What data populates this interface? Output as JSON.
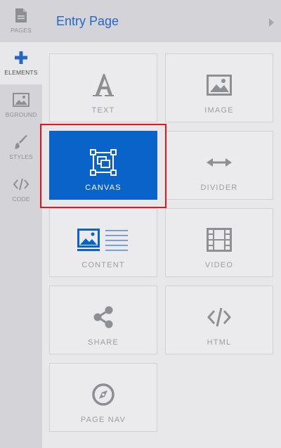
{
  "rail": {
    "items": [
      {
        "label": "PAGES",
        "icon": "page-icon"
      },
      {
        "label": "ELEMENTS",
        "icon": "plus-icon"
      },
      {
        "label": "BGROUND",
        "icon": "image-icon"
      },
      {
        "label": "STYLES",
        "icon": "brush-icon"
      },
      {
        "label": "CODE",
        "icon": "code-icon"
      }
    ]
  },
  "header": {
    "title": "Entry Page"
  },
  "tiles": [
    {
      "label": "TEXT",
      "icon": "text-icon"
    },
    {
      "label": "IMAGE",
      "icon": "image-icon"
    },
    {
      "label": "CANVAS",
      "icon": "canvas-icon",
      "selected": true
    },
    {
      "label": "DIVIDER",
      "icon": "divider-icon"
    },
    {
      "label": "CONTENT",
      "icon": "content-icon"
    },
    {
      "label": "VIDEO",
      "icon": "video-icon"
    },
    {
      "label": "SHARE",
      "icon": "share-icon"
    },
    {
      "label": "HTML",
      "icon": "code-icon"
    },
    {
      "label": "PAGE NAV",
      "icon": "compass-icon"
    }
  ],
  "colors": {
    "accent": "#2467c7",
    "selected_tile": "#0a63c9",
    "highlight": "#e0181c"
  }
}
